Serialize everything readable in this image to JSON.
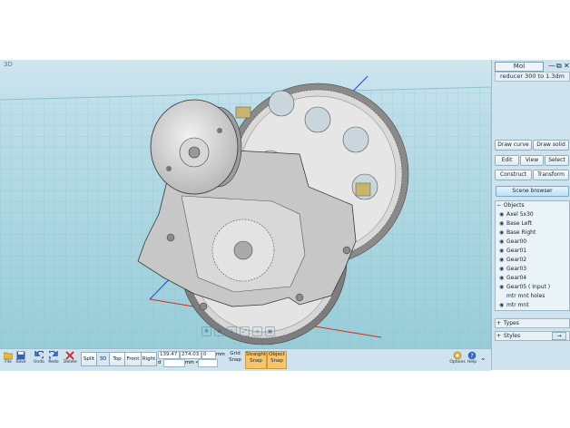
{
  "app": {
    "logo": "MoI",
    "document_title": "reducer 300 to 1.3dm"
  },
  "viewport": {
    "label": "3D"
  },
  "panel": {
    "buttons": {
      "draw_curve": "Draw curve",
      "draw_solid": "Draw solid",
      "edit": "Edit",
      "view": "View",
      "select": "Select",
      "construct": "Construct",
      "transform": "Transform",
      "scene_browser": "Scene browser"
    },
    "objects_header": "Objects",
    "objects": [
      "Axel 5x30",
      "Base Left",
      "Base Right",
      "Gear00",
      "Gear01",
      "Gear02",
      "Gear03",
      "Gear04",
      "Gear05 ( Input )",
      "mtr mnt holes",
      "mtr mnt"
    ],
    "types_header": "Types",
    "styles_header": "Styles"
  },
  "toolbar": {
    "file": "File",
    "save": "Save",
    "undo": "Undo",
    "redo": "Redo",
    "delete": "Delete",
    "views": {
      "split": "Split",
      "three_d": "3D",
      "top": "Top",
      "front": "Front",
      "right": "Right"
    },
    "coords": {
      "x": "139.47",
      "y": "274.03",
      "z": "0",
      "unit": "mm",
      "d_label": "d",
      "d_unit": "mm <"
    },
    "grid_snap": "Grid Snap",
    "straight_snap": "Straight Snap",
    "object_snap": "Object Snap",
    "options": "Options",
    "help": "Help"
  },
  "colors": {
    "accent": "#f5c56d",
    "grid_bg": "#9fd0da",
    "panel_bg": "#cfe3ee",
    "axis_x": "#d9281e",
    "axis_y": "#2846d8"
  }
}
